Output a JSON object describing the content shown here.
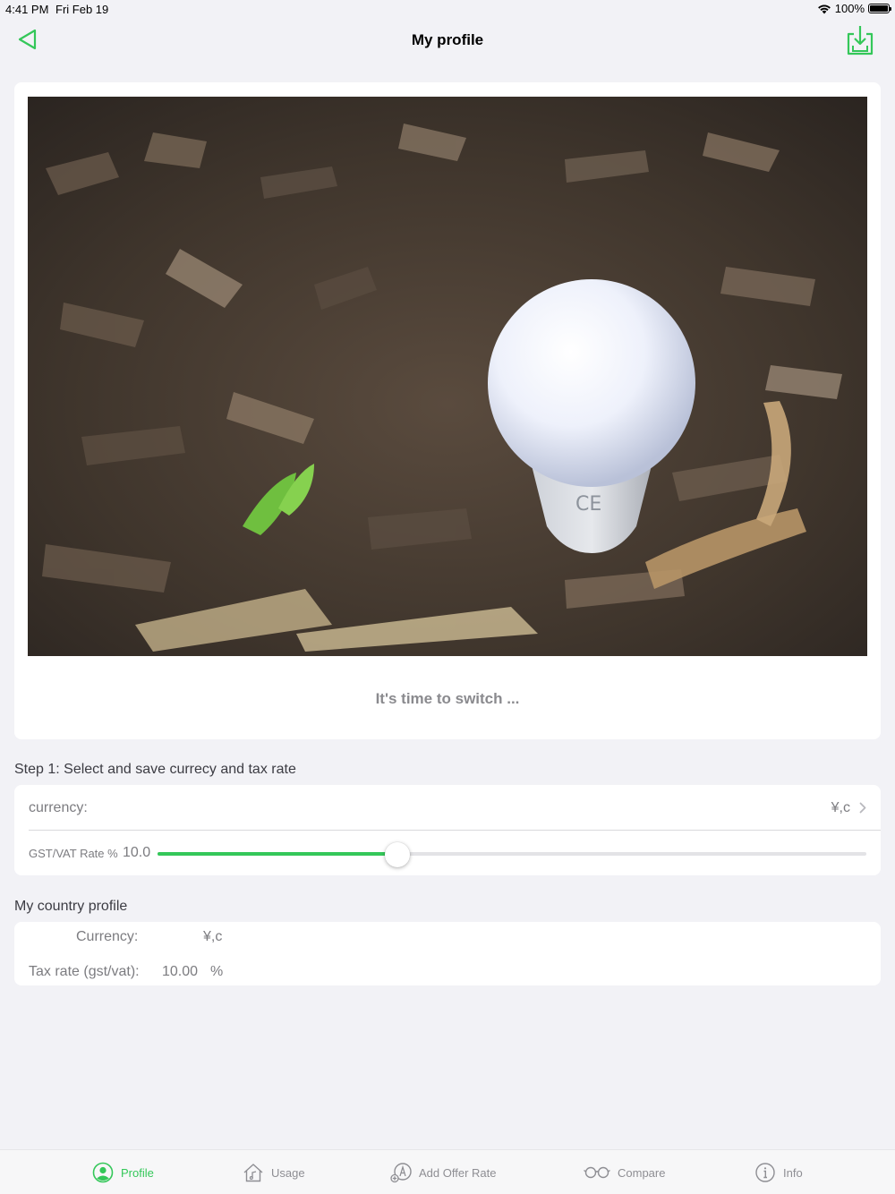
{
  "status_bar": {
    "time": "4:41 PM",
    "date": "Fri Feb 19",
    "battery": "100%"
  },
  "nav": {
    "title": "My profile",
    "back_icon": "back-triangle-icon",
    "action_icon": "download-tray-icon"
  },
  "hero": {
    "caption": "It's time to switch ...",
    "photo_subject": "light bulb on wood mulch"
  },
  "step1": {
    "title": "Step 1: Select and save currecy and tax rate",
    "currency_label": "currency:",
    "currency_value": "¥,c",
    "rate_label": "GST/VAT Rate %",
    "rate_value": "10.0",
    "slider_fraction": 0.338
  },
  "country_profile": {
    "title": "My country profile",
    "currency_label": "Currency:",
    "currency_value": "¥,c",
    "tax_label": "Tax rate (gst/vat):",
    "tax_value": "10.00",
    "tax_unit": "%"
  },
  "tabs": [
    {
      "label": "Profile",
      "icon": "person-circle-icon",
      "active": true
    },
    {
      "label": "Usage",
      "icon": "house-icon",
      "active": false
    },
    {
      "label": "Add Offer Rate",
      "icon": "add-offer-icon",
      "active": false
    },
    {
      "label": "Compare",
      "icon": "glasses-icon",
      "active": false
    },
    {
      "label": "Info",
      "icon": "info-circle-icon",
      "active": false
    }
  ],
  "colors": {
    "accent": "#34c759",
    "background": "#f2f2f6",
    "secondary_text": "#7c7c80"
  }
}
